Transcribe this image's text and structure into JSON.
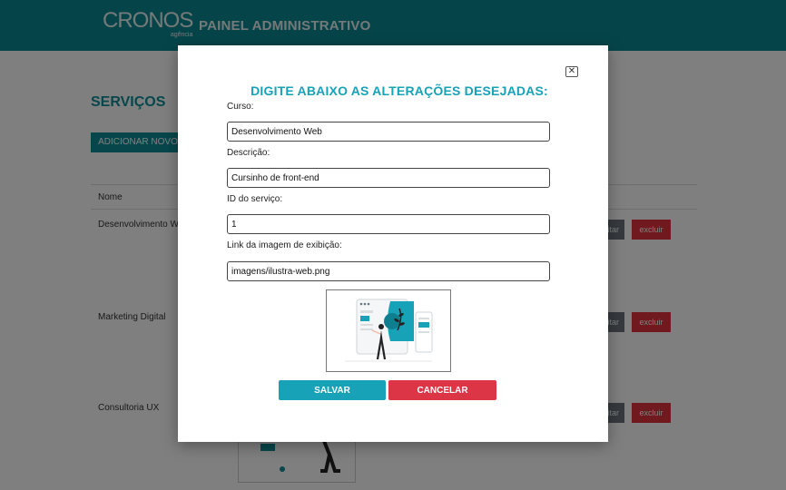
{
  "header": {
    "logo_text": "CRONOS",
    "logo_subtext": "agência",
    "panel_title": "PAINEL ADMINISTRATIVO"
  },
  "background": {
    "heading": "SERVIÇOS",
    "add_button_label": "ADICIONAR NOVO",
    "table": {
      "column_name": "Nome",
      "rows": [
        {
          "name": "Desenvolvimento Web",
          "edit_label": "editar",
          "delete_label": "excluir"
        },
        {
          "name": "Marketing Digital",
          "edit_label": "editar",
          "delete_label": "excluir"
        },
        {
          "name": "Consultoria UX",
          "edit_label": "editar",
          "delete_label": "excluir"
        }
      ]
    }
  },
  "modal": {
    "close_symbol": "✕",
    "title": "DIGITE ABAIXO AS ALTERAÇÕES DESEJADAS:",
    "fields": [
      {
        "label": "Curso:",
        "value": "Desenvolvimento Web"
      },
      {
        "label": "Descrição:",
        "value": "Cursinho de front-end"
      },
      {
        "label": "ID do serviço:",
        "value": "1"
      },
      {
        "label": "Link da imagem de exibição:",
        "value": "imagens/ilustra-web.png"
      }
    ],
    "save_label": "SALVAR",
    "cancel_label": "CANCELAR"
  },
  "colors": {
    "brand_teal": "#0a8a93",
    "accent_teal": "#17a2b8",
    "danger_red": "#dc3545",
    "secondary_gray": "#6c757d"
  }
}
